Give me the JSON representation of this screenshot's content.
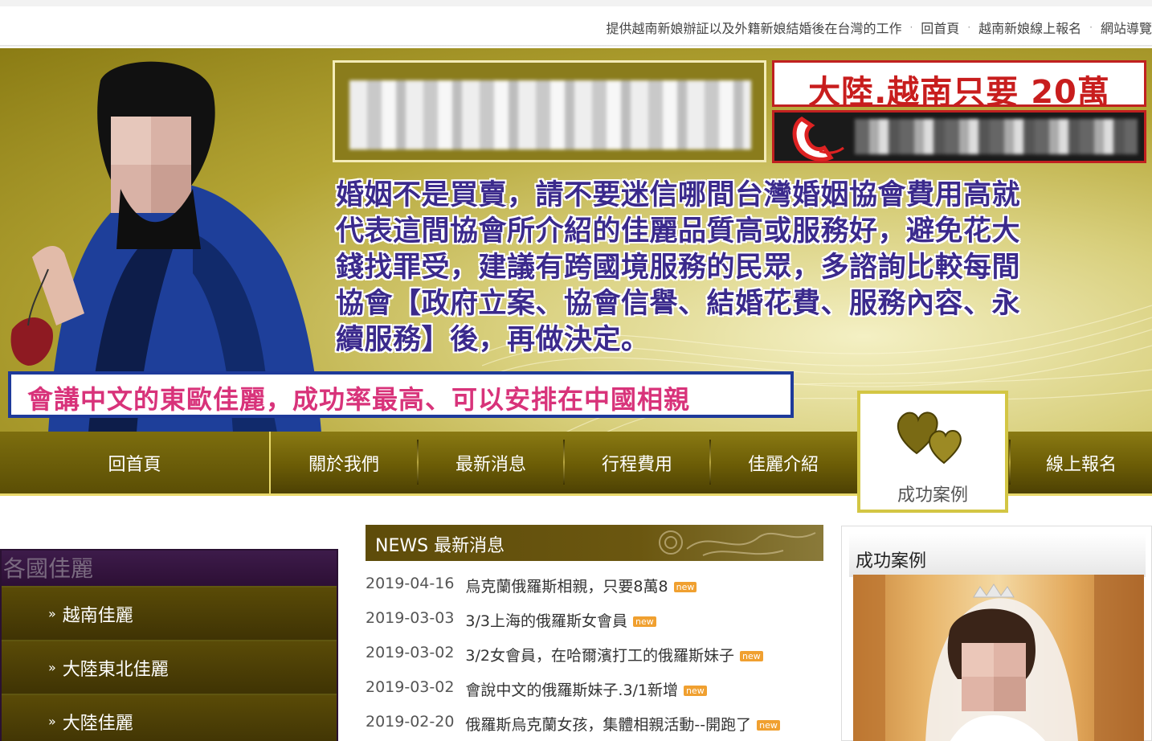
{
  "topbar": {
    "tagline": "提供越南新娘辦証以及外籍新娘結婚後在台灣的工作",
    "home": "回首頁",
    "register": "越南新娘線上報名",
    "sitemap": "網站導覽"
  },
  "banner": {
    "promo": "大陸.越南只要 20萬",
    "slogan": [
      "婚姻不是買賣，請不要迷信哪間台灣婚姻協會費用高就",
      "代表這間協會所介紹的佳麗品質高或服務好，避免花大",
      "錢找罪受，建議有跨國境服務的民眾，多諮詢比較每間",
      "協會【政府立案、協會信譽、結婚花費、服務內容、永",
      "續服務】後，再做決定。"
    ],
    "notice": "會講中文的東歐佳麗，成功率最高、可以安排在中國相親"
  },
  "nav": {
    "items": [
      "回首頁",
      "關於我們",
      "最新消息",
      "行程費用",
      "佳麗介紹",
      "成功案例",
      "線上報名"
    ]
  },
  "sidebar": {
    "title": "各國佳麗",
    "items": [
      "越南佳麗",
      "大陸東北佳麗",
      "大陸佳麗"
    ]
  },
  "news": {
    "title": "NEWS 最新消息",
    "badge": "new",
    "items": [
      {
        "date": "2019-04-16",
        "title": "烏克蘭俄羅斯相親，只要8萬8"
      },
      {
        "date": "2019-03-03",
        "title": "3/3上海的俄羅斯女會員"
      },
      {
        "date": "2019-03-02",
        "title": "3/2女會員，在哈爾濱打工的俄羅斯妹子"
      },
      {
        "date": "2019-03-02",
        "title": "會說中文的俄羅斯妹子.3/1新增"
      },
      {
        "date": "2019-02-20",
        "title": "俄羅斯烏克蘭女孩，集體相親活動--開跑了"
      }
    ]
  },
  "cases": {
    "title": "成功案例"
  },
  "colors": {
    "nav_bg": "#6b5c06",
    "accent_gold": "#e9d96b",
    "slogan_text": "#3b2a8c",
    "promo_red": "#c81d1d",
    "notice_pink": "#d8337a",
    "sidebar_purple": "#3b1c45",
    "new_badge": "#f0a030"
  }
}
